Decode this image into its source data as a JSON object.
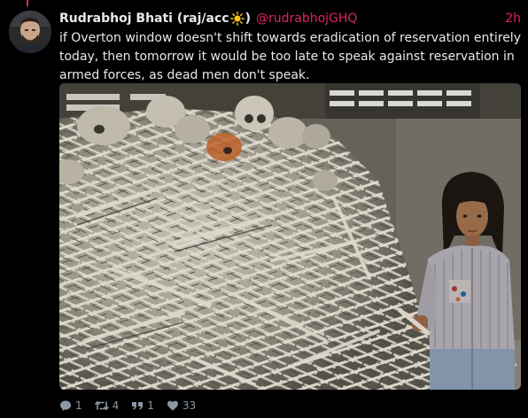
{
  "tweet": {
    "display_name": "Rudrabhoj Bhati (raj/acc",
    "display_name_emoji": "sun-emoji",
    "display_name_close": ")",
    "handle": "@rudrabhojGHQ",
    "time": "2h",
    "text": "if Overton window doesn't shift towards eradication of reservation entirely today, then tomorrow it would be too late to speak against reservation in armed forces, as dead men don't speak.",
    "media_icon": "photo-ossuary"
  },
  "actions": {
    "replies": "1",
    "retweets": "4",
    "quotes": "1",
    "likes": "33"
  },
  "colors": {
    "accent": "#e0245e",
    "background": "#000000",
    "text": "#e7e9ea",
    "muted": "#8b98a5"
  }
}
